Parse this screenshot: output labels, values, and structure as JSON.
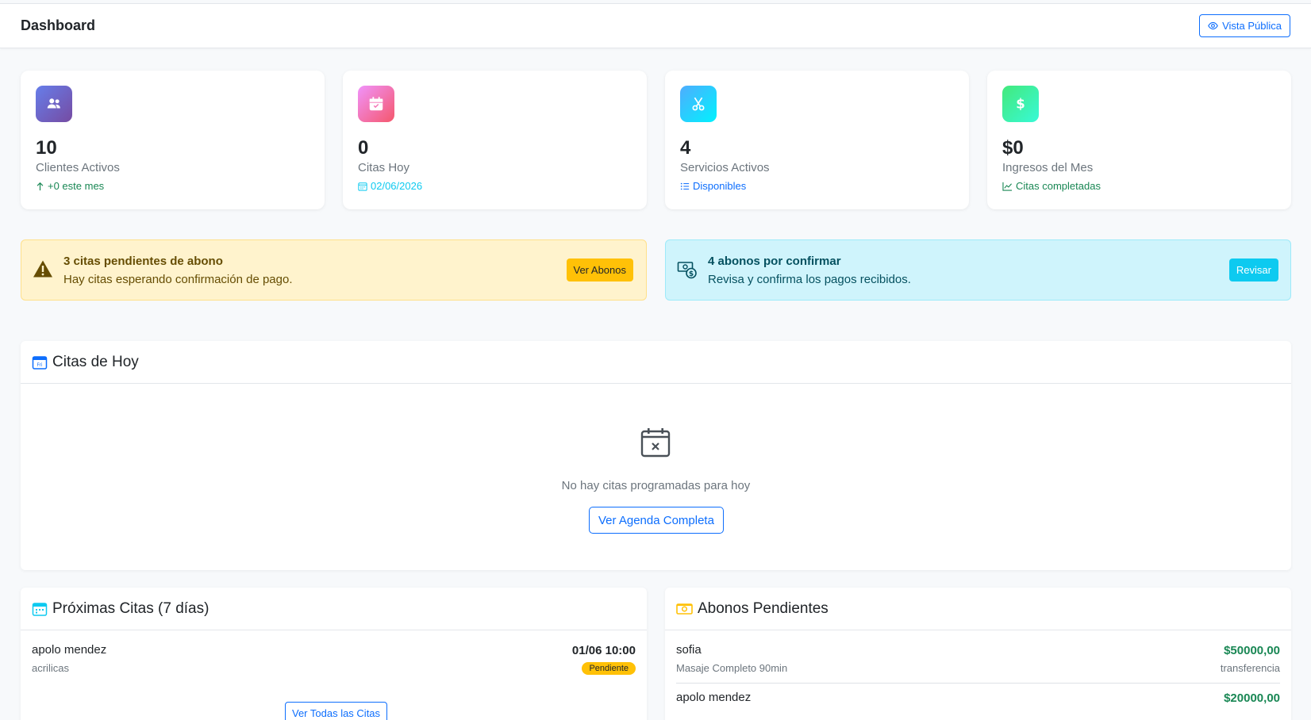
{
  "header": {
    "title": "Dashboard",
    "public_view_label": "Vista Pública"
  },
  "stats": [
    {
      "value": "10",
      "label": "Clientes Activos",
      "sub": "+0 este mes",
      "icon": "users-icon",
      "gradient": [
        "#667eea",
        "#764ba2"
      ],
      "sub_color": "#198754"
    },
    {
      "value": "0",
      "label": "Citas Hoy",
      "sub": "02/06/2026",
      "icon": "calendar-check-icon",
      "gradient": [
        "#f093fb",
        "#f5576c"
      ],
      "sub_color": "#0dcaf0"
    },
    {
      "value": "4",
      "label": "Servicios Activos",
      "sub": "Disponibles",
      "icon": "scissors-icon",
      "gradient": [
        "#4facfe",
        "#00f2fe"
      ],
      "sub_color": "#0d6efd"
    },
    {
      "value": "$0",
      "label": "Ingresos del Mes",
      "sub": "Citas completadas",
      "icon": "dollar-icon",
      "gradient": [
        "#43e97b",
        "#38f9d7"
      ],
      "sub_color": "#198754"
    }
  ],
  "alerts": {
    "warning": {
      "title": "3 citas pendientes de abono",
      "text": "Hay citas esperando confirmación de pago.",
      "button": "Ver Abonos"
    },
    "info": {
      "title": "4 abonos por confirmar",
      "text": "Revisa y confirma los pagos recibidos.",
      "button": "Revisar"
    }
  },
  "today": {
    "title": "Citas de Hoy",
    "empty_text": "No hay citas programadas para hoy",
    "button": "Ver Agenda Completa"
  },
  "upcoming": {
    "title": "Próximas Citas (7 días)",
    "items": [
      {
        "name": "apolo mendez",
        "service": "acrilicas",
        "datetime": "01/06 10:00",
        "status": "Pendiente"
      }
    ],
    "button": "Ver Todas las Citas"
  },
  "pending": {
    "title": "Abonos Pendientes",
    "items": [
      {
        "name": "sofia",
        "service": "Masaje Completo 90min",
        "amount": "$50000,00",
        "method": "transferencia"
      },
      {
        "name": "apolo mendez",
        "amount": "$20000,00"
      }
    ]
  },
  "colors": {
    "primary": "#0d6efd",
    "warning": "#ffc107",
    "info": "#0dcaf0",
    "success": "#198754"
  }
}
